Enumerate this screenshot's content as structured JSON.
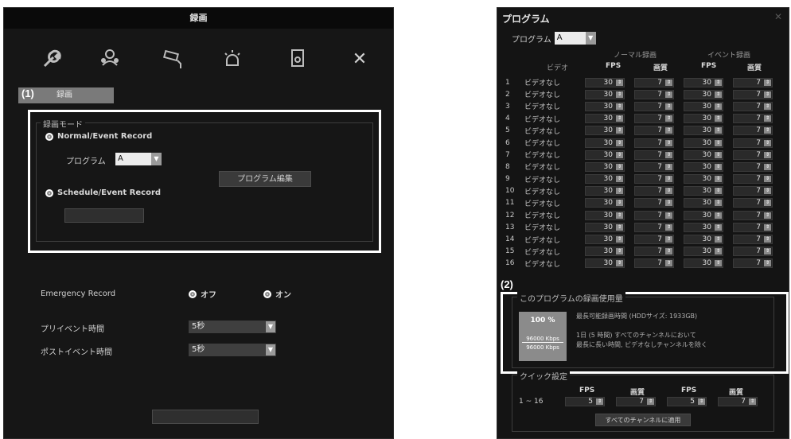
{
  "left": {
    "title": "録画",
    "tab": "録画",
    "marker": "(1)",
    "group_title": "録画モード",
    "mode_normal": "Normal/Event Record",
    "program_label": "プログラム",
    "program_value": "A",
    "program_edit_button": "プログラム編集",
    "mode_schedule": "Schedule/Event Record",
    "emergency_label": "Emergency Record",
    "off": "オフ",
    "on": "オン",
    "pre_event_label": "プリイベント時間",
    "pre_event_value": "5秒",
    "post_event_label": "ポストイベント時間",
    "post_event_value": "5秒",
    "icons": [
      "wrench-icon",
      "user-group-icon",
      "camera-icon",
      "alarm-icon",
      "disk-icon",
      "close-icon"
    ]
  },
  "right": {
    "title": "プログラム",
    "close": "✕",
    "program_label": "プログラム",
    "program_value": "A",
    "normal_header": "ノーマル録画",
    "event_header": "イベント録画",
    "col_video": "ビデオ",
    "col_fps": "FPS",
    "col_quality": "画質",
    "rows": [
      {
        "no": "1",
        "video": "ビデオなし",
        "nfps": "30",
        "nq": "7",
        "efps": "30",
        "eq": "7"
      },
      {
        "no": "2",
        "video": "ビデオなし",
        "nfps": "30",
        "nq": "7",
        "efps": "30",
        "eq": "7"
      },
      {
        "no": "3",
        "video": "ビデオなし",
        "nfps": "30",
        "nq": "7",
        "efps": "30",
        "eq": "7"
      },
      {
        "no": "4",
        "video": "ビデオなし",
        "nfps": "30",
        "nq": "7",
        "efps": "30",
        "eq": "7"
      },
      {
        "no": "5",
        "video": "ビデオなし",
        "nfps": "30",
        "nq": "7",
        "efps": "30",
        "eq": "7"
      },
      {
        "no": "6",
        "video": "ビデオなし",
        "nfps": "30",
        "nq": "7",
        "efps": "30",
        "eq": "7"
      },
      {
        "no": "7",
        "video": "ビデオなし",
        "nfps": "30",
        "nq": "7",
        "efps": "30",
        "eq": "7"
      },
      {
        "no": "8",
        "video": "ビデオなし",
        "nfps": "30",
        "nq": "7",
        "efps": "30",
        "eq": "7"
      },
      {
        "no": "9",
        "video": "ビデオなし",
        "nfps": "30",
        "nq": "7",
        "efps": "30",
        "eq": "7"
      },
      {
        "no": "10",
        "video": "ビデオなし",
        "nfps": "30",
        "nq": "7",
        "efps": "30",
        "eq": "7"
      },
      {
        "no": "11",
        "video": "ビデオなし",
        "nfps": "30",
        "nq": "7",
        "efps": "30",
        "eq": "7"
      },
      {
        "no": "12",
        "video": "ビデオなし",
        "nfps": "30",
        "nq": "7",
        "efps": "30",
        "eq": "7"
      },
      {
        "no": "13",
        "video": "ビデオなし",
        "nfps": "30",
        "nq": "7",
        "efps": "30",
        "eq": "7"
      },
      {
        "no": "14",
        "video": "ビデオなし",
        "nfps": "30",
        "nq": "7",
        "efps": "30",
        "eq": "7"
      },
      {
        "no": "15",
        "video": "ビデオなし",
        "nfps": "30",
        "nq": "7",
        "efps": "30",
        "eq": "7"
      },
      {
        "no": "16",
        "video": "ビデオなし",
        "nfps": "30",
        "nq": "7",
        "efps": "30",
        "eq": "7"
      }
    ],
    "marker": "(2)",
    "usage_title": "このプログラムの録画使用量",
    "usage_percent": "100 %",
    "usage_kbps_1": "96000 Kbps",
    "usage_kbps_2": "96000 Kbps",
    "usage_line1": "最長可能録画時間 (HDDサイズ: 1933GB)",
    "usage_line2": "1日 (5 時間) すべてのチャンネルにおいて",
    "usage_line3": "最長に長い時間, ビデオなしチャンネルを除く",
    "quick_title": "クイック設定",
    "quick_range": "1 ~ 16",
    "quick_nfps": "5",
    "quick_nq": "7",
    "quick_efps": "5",
    "quick_eq": "7",
    "apply_all": "すべてのチャンネルに適用"
  }
}
